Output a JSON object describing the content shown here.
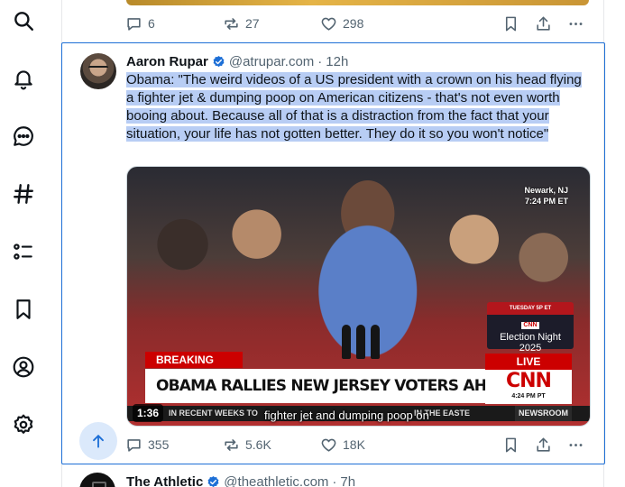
{
  "nav": {
    "items": [
      "search",
      "notifications",
      "messages",
      "trends",
      "lists",
      "bookmarks",
      "profile",
      "settings"
    ]
  },
  "previous_post": {
    "replies": "6",
    "reposts": "27",
    "likes": "298"
  },
  "post": {
    "author_name": "Aaron Rupar",
    "handle": "@atrupar.com",
    "separator": "·",
    "time": "12h",
    "text": "Obama: \"The weird videos of a US president with a crown on his head flying a fighter jet & dumping poop on American citizens - that's not even worth booing about. Because all of that is a distraction from the fact that your situation, your life has not gotten better. They do it so you won't notice\"",
    "replies": "355",
    "reposts": "5.6K",
    "likes": "18K",
    "video": {
      "duration": "1:36",
      "location": "Newark, NJ",
      "location_time": "7:24 PM ET",
      "election_date": "TUESDAY 5P ET",
      "election_network": "CNN",
      "election_title": "Election Night",
      "election_year": "2025",
      "breaking_label": "BREAKING NEWS",
      "headline": "OBAMA RALLIES NEW JERSEY VOTERS AHEAD OF ELECTION DAY",
      "live_label": "LIVE",
      "network_logo": "CNN",
      "network_time": "4:24 PM PT",
      "ticker": "IN RECENT WEEKS TO",
      "ticker_end": "IN THE EASTE",
      "newsroom_label": "NEWSROOM",
      "caption": "fighter jet and dumping poop on"
    }
  },
  "next_post": {
    "author_name": "The Athletic",
    "handle": "@theathletic.com",
    "separator": "·",
    "time": "7h"
  },
  "colors": {
    "accent": "#1d6fd6",
    "highlight": "#b8cdf4",
    "muted": "#536471",
    "verified": "#1d6fd6"
  }
}
